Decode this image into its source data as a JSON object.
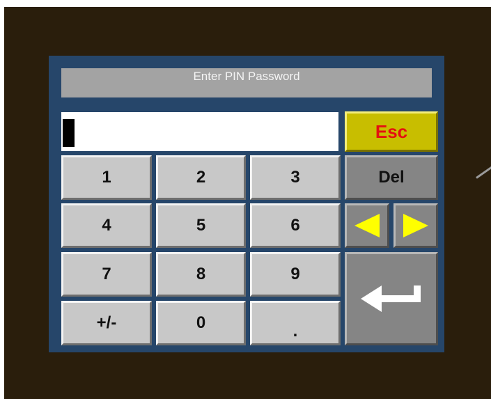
{
  "dialog": {
    "title": "Enter PIN Password"
  },
  "pin_field": {
    "value": ""
  },
  "keypad": {
    "keys": [
      "1",
      "2",
      "3",
      "4",
      "5",
      "6",
      "7",
      "8",
      "9",
      "+/-",
      "0",
      "."
    ],
    "esc_label": "Esc",
    "del_label": "Del"
  },
  "icons": {
    "left_arrow": "arrow-left-icon",
    "right_arrow": "arrow-right-icon",
    "enter": "enter-return-icon"
  },
  "colors": {
    "background": "#2a1e0c",
    "panel": "#26466a",
    "title_bar": "#a3a3a3",
    "key": "#c8c8c8",
    "key_dark": "#858585",
    "esc_bg": "#c8be00",
    "esc_text": "#e41010",
    "arrow": "#ffff00"
  }
}
